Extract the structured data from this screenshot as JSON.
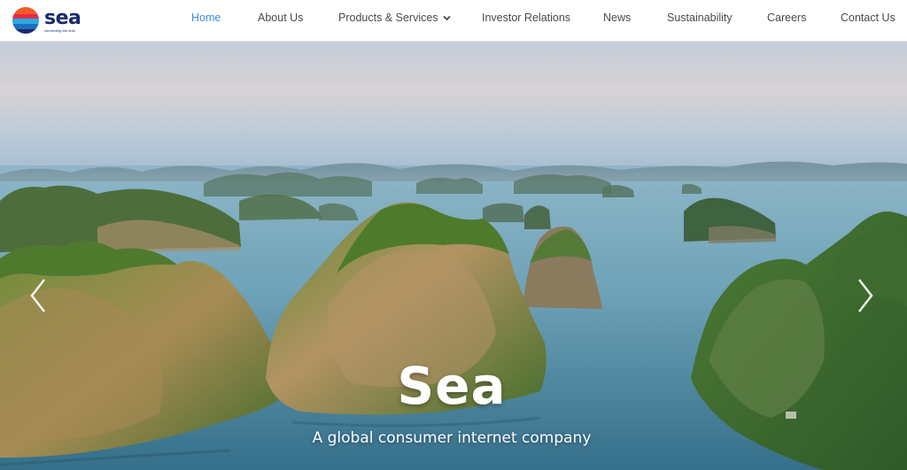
{
  "brand": {
    "name": "sea",
    "tagline": "connecting the dots",
    "logo_icon": "sea-logo-icon"
  },
  "nav": {
    "items": [
      {
        "label": "Home",
        "active": true
      },
      {
        "label": "About Us"
      },
      {
        "label": "Products & Services",
        "has_dropdown": true
      },
      {
        "label": "Investor Relations"
      },
      {
        "label": "News"
      },
      {
        "label": "Sustainability"
      },
      {
        "label": "Careers"
      },
      {
        "label": "Contact Us"
      }
    ]
  },
  "hero": {
    "title": "Sea",
    "subtitle": "A global consumer internet company",
    "prev_icon": "chevron-left-icon",
    "next_icon": "chevron-right-icon"
  },
  "colors": {
    "nav_active": "#3f8edc",
    "nav_text": "#4a4a4a",
    "brand": "#1a2a6c"
  }
}
